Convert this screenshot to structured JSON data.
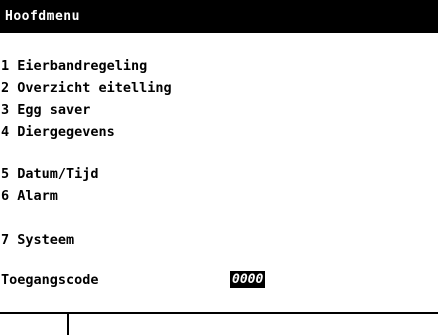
{
  "header": {
    "title": "Hoofdmenu"
  },
  "menu": {
    "items": [
      {
        "label": "1 Eierbandregeling"
      },
      {
        "label": "2 Overzicht eitelling"
      },
      {
        "label": "3 Egg saver"
      },
      {
        "label": "4 Diergegevens"
      },
      {
        "label": "5 Datum/Tijd"
      },
      {
        "label": "6 Alarm"
      },
      {
        "label": "7 Systeem"
      }
    ]
  },
  "access": {
    "label": "Toegangscode",
    "value": "0000"
  },
  "colors": {
    "background": "#ffffff",
    "foreground": "#000000"
  }
}
